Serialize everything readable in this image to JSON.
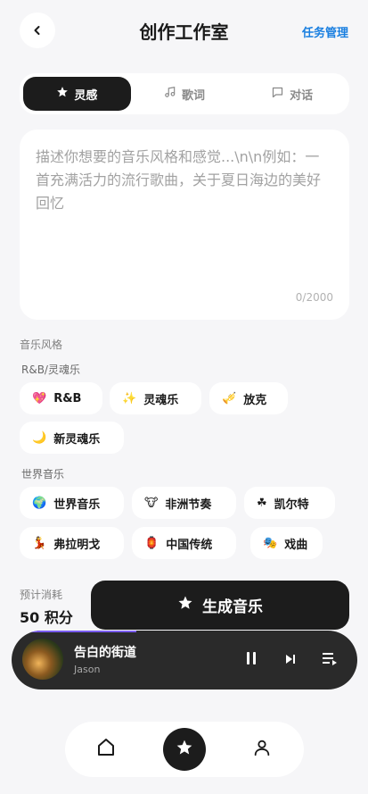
{
  "header": {
    "title": "创作工作室",
    "task_link": "任务管理",
    "back_icon": "chevron-left-icon"
  },
  "tabs": [
    {
      "label": "灵感",
      "icon": "star-icon",
      "active": true
    },
    {
      "label": "歌词",
      "icon": "music-note-icon",
      "active": false
    },
    {
      "label": "对话",
      "icon": "chat-bubble-icon",
      "active": false
    }
  ],
  "prompt": {
    "value": "",
    "placeholder": "描述你想要的音乐风格和感觉...\\n\\n例如：一首充满活力的流行歌曲，关于夏日海边的美好回忆",
    "counter": "0/2000"
  },
  "styles": {
    "label": "音乐风格",
    "groups": [
      {
        "name": "R&B/灵魂乐",
        "items": [
          {
            "emoji": "💖",
            "label": "R&B"
          },
          {
            "emoji": "✨",
            "label": "灵魂乐"
          },
          {
            "emoji": "🎺",
            "label": "放克"
          },
          {
            "emoji": "🌙",
            "label": "新灵魂乐"
          }
        ]
      },
      {
        "name": "世界音乐",
        "items": [
          {
            "emoji": "🌍",
            "label": "世界音乐"
          },
          {
            "emoji": "🐮",
            "label": "非洲节奏"
          },
          {
            "emoji": "☘",
            "label": "凯尔特"
          },
          {
            "emoji": "💃",
            "label": "弗拉明戈"
          },
          {
            "emoji": "🏮",
            "label": "中国传统"
          },
          {
            "emoji": "🎭",
            "label": "戏曲"
          }
        ]
      }
    ]
  },
  "cost": {
    "label": "预计消耗",
    "value": "50 积分"
  },
  "generate": {
    "label": "生成音乐",
    "icon": "star-icon"
  },
  "player": {
    "title": "告白的街道",
    "artist": "Jason",
    "progress": 0.2
  },
  "bottom_nav": [
    {
      "name": "home",
      "icon": "home-icon",
      "active": false
    },
    {
      "name": "create",
      "icon": "star-icon",
      "active": true
    },
    {
      "name": "profile",
      "icon": "user-icon",
      "active": false
    }
  ]
}
